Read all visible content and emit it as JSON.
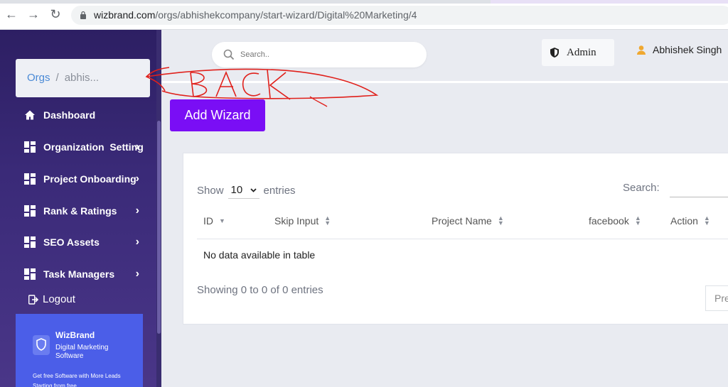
{
  "browser": {
    "url_host": "wizbrand.com",
    "url_path": "/orgs/abhishekcompany/start-wizard/Digital%20Marketing/4"
  },
  "sidebar": {
    "breadcrumb": {
      "root": "Orgs",
      "separator": "/",
      "current": "abhis..."
    },
    "items": [
      {
        "label": "Dashboard",
        "icon": "home-icon",
        "has_chevron": false
      },
      {
        "label": "Organization  Setting",
        "icon": "grid-icon",
        "has_chevron": true
      },
      {
        "label": "Project Onboarding",
        "icon": "grid-icon",
        "has_chevron": true
      },
      {
        "label": "Rank & Ratings",
        "icon": "grid-icon",
        "has_chevron": true
      },
      {
        "label": "SEO Assets",
        "icon": "grid-icon",
        "has_chevron": true
      },
      {
        "label": "Task Managers",
        "icon": "grid-icon",
        "has_chevron": true
      }
    ],
    "logout_label": "Logout",
    "promo": {
      "brand": "WizBrand",
      "subtitle": "Digital Marketing Software",
      "tagline": "Get free Software with More Leads Starting from free"
    }
  },
  "header": {
    "search_placeholder": "Search..",
    "role_label": "Admin",
    "user_name": "Abhishek Singh"
  },
  "main": {
    "add_button_label": "Add Wizard",
    "table": {
      "show_label": "Show",
      "entries_label": "entries",
      "length_value": "10",
      "search_label": "Search:",
      "columns": [
        "ID",
        "Skip Input",
        "Project Name",
        "facebook",
        "Action"
      ],
      "empty_message": "No data available in table",
      "info": "Showing 0 to 0 of 0 entries",
      "prev_label": "Pre"
    }
  },
  "annotation": {
    "text": "BACK",
    "color": "#e0201b"
  },
  "colors": {
    "sidebar_bg": "#2d1f63",
    "primary_button": "#7a0ef5",
    "promo_bg": "#4b5ee8",
    "link_blue": "#4a8ad6"
  }
}
